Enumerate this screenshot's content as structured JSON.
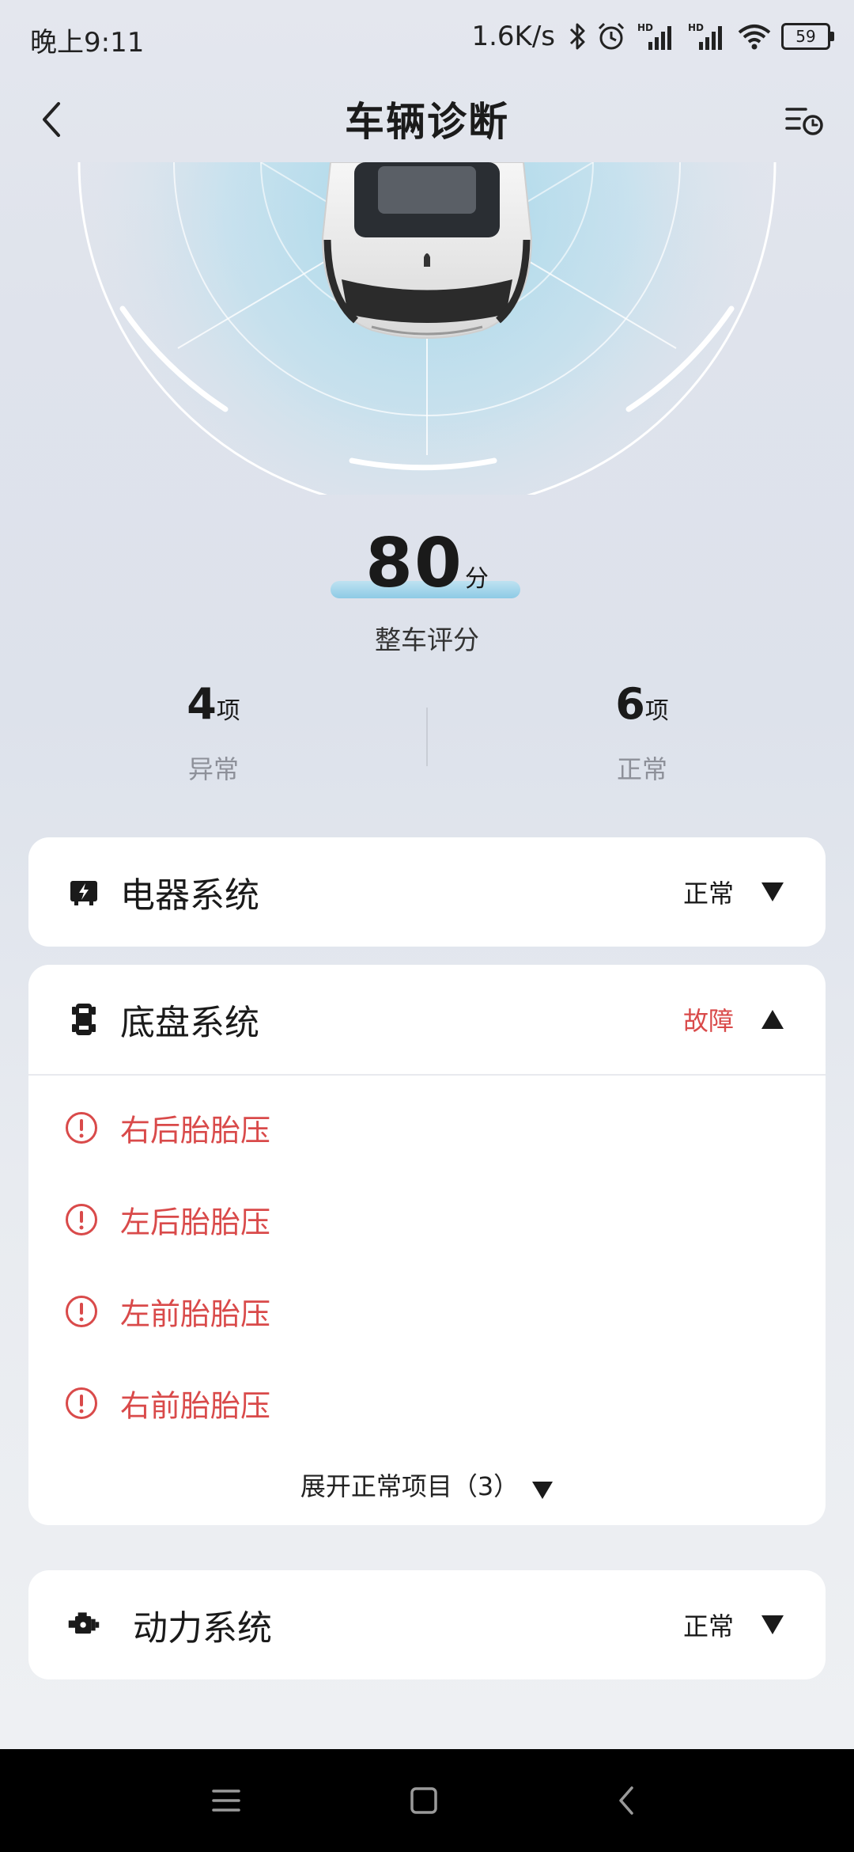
{
  "status_bar": {
    "time": "晚上9:11",
    "speed": "1.6K/s",
    "battery": "59",
    "icons": [
      "bluetooth-icon",
      "alarm-icon",
      "hd-signal-icon",
      "hd-signal-icon",
      "wifi-icon",
      "battery-icon"
    ]
  },
  "header": {
    "title": "车辆诊断",
    "back_icon": "chevron-left-icon",
    "history_icon": "list-history-icon"
  },
  "score": {
    "value": "80",
    "unit": "分",
    "label": "整车评分"
  },
  "stats": {
    "abnormal": {
      "count": "4",
      "unit": "项",
      "label": "异常"
    },
    "normal": {
      "count": "6",
      "unit": "项",
      "label": "正常"
    }
  },
  "cards": {
    "electrical": {
      "name": "电器系统",
      "status": "正常",
      "icon": "electrical-icon",
      "expanded": false
    },
    "chassis": {
      "name": "底盘系统",
      "status": "故障",
      "icon": "chassis-icon",
      "expanded": true,
      "faults": [
        "右后胎胎压",
        "左后胎胎压",
        "左前胎胎压",
        "右前胎胎压"
      ],
      "expand_label": "展开正常项目（3）"
    },
    "power": {
      "name": "动力系统",
      "status": "正常",
      "icon": "engine-icon",
      "expanded": false
    }
  },
  "colors": {
    "fault": "#d94a4a",
    "accent_blue": "#7fc6e4",
    "card_bg": "#ffffff"
  }
}
